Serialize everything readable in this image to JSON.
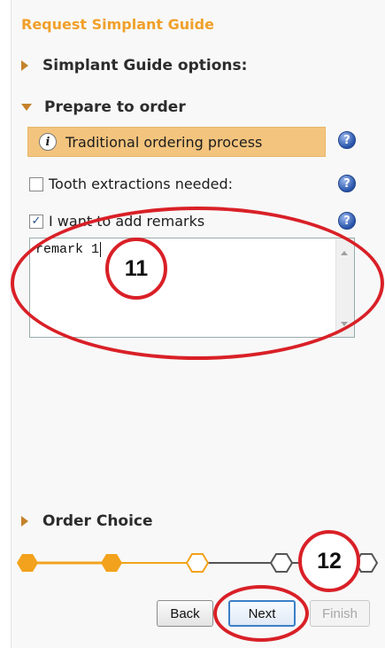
{
  "window": {
    "title": "Request Simplant Guide"
  },
  "sections": {
    "guide_options": "Simplant Guide options:",
    "prepare": "Prepare to order",
    "order_choice": "Order Choice"
  },
  "info": {
    "text": "Traditional ordering process",
    "icon": "info-icon"
  },
  "options": {
    "tooth_extractions": {
      "label": "Tooth extractions needed:",
      "checked": false
    },
    "add_remarks": {
      "label": "I want to add remarks",
      "checked": true
    }
  },
  "help": {
    "symbol": "?"
  },
  "remarks": {
    "value": "remark 1"
  },
  "steps": {
    "completed": 2,
    "current": 3,
    "total": 5
  },
  "buttons": {
    "back": "Back",
    "next": "Next",
    "finish": "Finish"
  },
  "annotations": {
    "remarks_callout": "11",
    "next_callout": "12"
  },
  "colors": {
    "accent": "#f0a02a",
    "step_complete": "#f2a21c",
    "highlight_bar": "#f3c47e",
    "annotation_red": "#d92027"
  }
}
